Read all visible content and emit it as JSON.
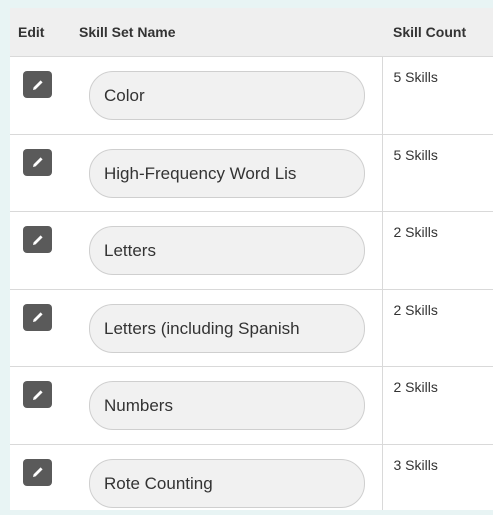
{
  "table": {
    "headers": {
      "edit": "Edit",
      "name": "Skill Set Name",
      "count": "Skill Count"
    },
    "rows": [
      {
        "name": "Color",
        "count": "5 Skills"
      },
      {
        "name": "High-Frequency Word Lis",
        "count": "5 Skills"
      },
      {
        "name": "Letters",
        "count": "2 Skills"
      },
      {
        "name": "Letters (including Spanish",
        "count": "2 Skills"
      },
      {
        "name": "Numbers",
        "count": "2 Skills"
      },
      {
        "name": "Rote Counting",
        "count": "3 Skills"
      }
    ]
  },
  "icons": {
    "edit": "pencil-icon"
  },
  "colors": {
    "background": "#e8f4f4",
    "header_bg": "#efefef",
    "edit_button": "#5a5a5a",
    "field_bg": "#f1f1f1"
  }
}
